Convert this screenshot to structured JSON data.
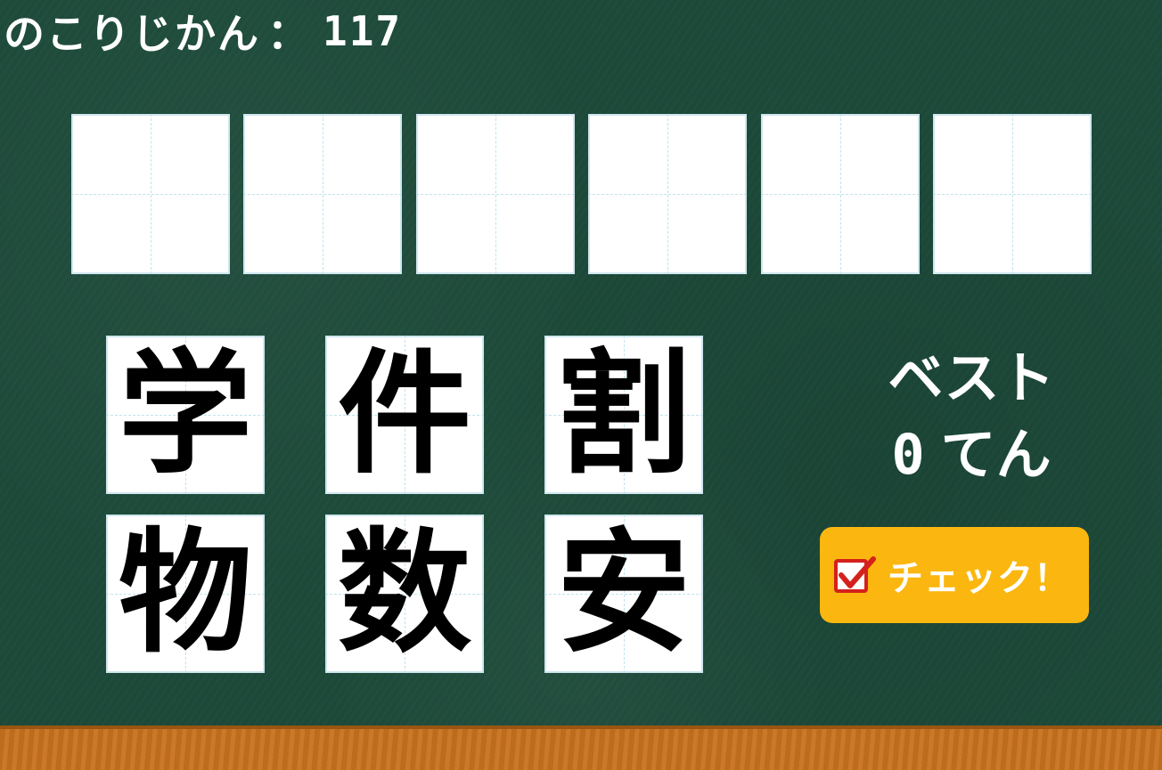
{
  "timer": {
    "label": "のこりじかん",
    "separator": "：",
    "value": "117"
  },
  "answer_slots": [
    "",
    "",
    "",
    "",
    "",
    ""
  ],
  "tiles": [
    "学",
    "件",
    "割",
    "物",
    "数",
    "安"
  ],
  "best": {
    "label": "ベスト",
    "score": "0",
    "unit": "てん"
  },
  "check_button": {
    "label": "チェック！",
    "icon": "checkbox-check-icon"
  },
  "colors": {
    "board": "#1d4a3a",
    "ledge": "#c9731f",
    "button": "#fbb710",
    "check_mark": "#d4211c",
    "guide_line": "#bfe3ee"
  }
}
